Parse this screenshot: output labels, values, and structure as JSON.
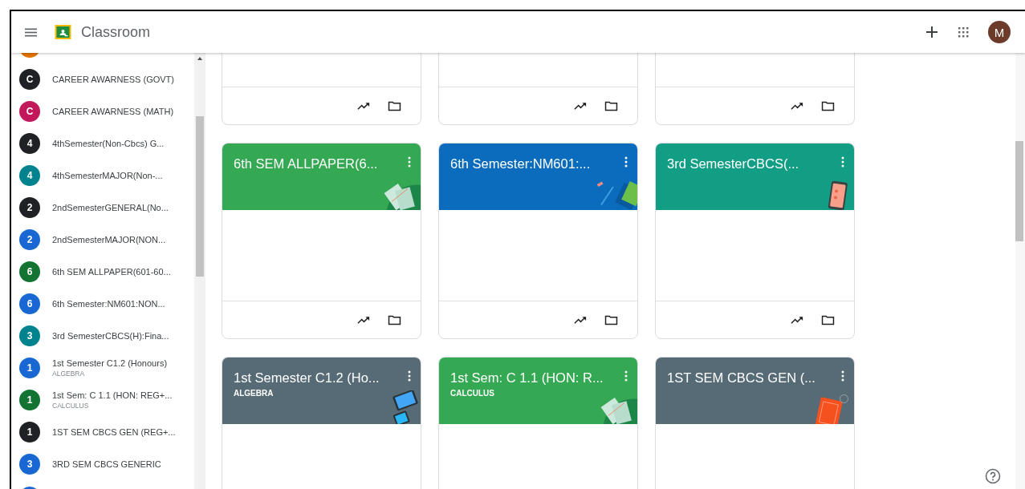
{
  "header": {
    "app_name": "Classroom",
    "avatar_letter": "M"
  },
  "sidebar": {
    "items": [
      {
        "kind": "partial",
        "color": "#e37400"
      },
      {
        "kind": "class",
        "letter": "C",
        "name": "CAREER AWARNESS (GOVT)",
        "color": "#202124"
      },
      {
        "kind": "class",
        "letter": "C",
        "name": "CAREER AWARNESS (MATH)",
        "color": "#c2185b"
      },
      {
        "kind": "class",
        "letter": "4",
        "name": "4thSemester(Non-Cbcs) G...",
        "color": "#202124"
      },
      {
        "kind": "class",
        "letter": "4",
        "name": "4thSemesterMAJOR(Non-...",
        "color": "#00838f"
      },
      {
        "kind": "class",
        "letter": "2",
        "name": "2ndSemesterGENERAL(No...",
        "color": "#202124"
      },
      {
        "kind": "class",
        "letter": "2",
        "name": "2ndSemesterMAJOR(NON...",
        "color": "#1967d2"
      },
      {
        "kind": "class",
        "letter": "6",
        "name": "6th SEM ALLPAPER(601-60...",
        "color": "#137333"
      },
      {
        "kind": "class",
        "letter": "6",
        "name": "6th Semester:NM601:NON...",
        "color": "#1967d2"
      },
      {
        "kind": "class",
        "letter": "3",
        "name": "3rd SemesterCBCS(H):Fina...",
        "color": "#00838f"
      },
      {
        "kind": "class",
        "letter": "1",
        "name": "1st Semester C1.2 (Honours)",
        "subtitle": "ALGEBRA",
        "color": "#1967d2"
      },
      {
        "kind": "class",
        "letter": "1",
        "name": "1st Sem: C 1.1 (HON: REG+...",
        "subtitle": "CALCULUS",
        "color": "#137333"
      },
      {
        "kind": "class",
        "letter": "1",
        "name": "1ST SEM CBCS GEN (REG+...",
        "color": "#202124"
      },
      {
        "kind": "class",
        "letter": "3",
        "name": "3RD SEM CBCS GENERIC",
        "color": "#1967d2"
      },
      {
        "kind": "partial-bottom",
        "color": "#1967d2"
      }
    ]
  },
  "cards": [
    {
      "kind": "bottom"
    },
    {
      "kind": "bottom"
    },
    {
      "kind": "bottom"
    },
    {
      "kind": "full",
      "title": "6th SEM ALLPAPER(6...",
      "color": "#34a853",
      "illustration": {
        "kind": "book"
      }
    },
    {
      "kind": "full",
      "title": "6th Semester:NM601:...",
      "color": "#0b6cbd",
      "illustration": {
        "kind": "pen"
      }
    },
    {
      "kind": "full",
      "title": "3rd SemesterCBCS(...",
      "color": "#129d85",
      "illustration": {
        "kind": "phone"
      }
    },
    {
      "kind": "top",
      "title": "1st Semester C1.2 (Ho...",
      "subtitle": "ALGEBRA",
      "color": "#566b76",
      "illustration": {
        "kind": "tablet"
      }
    },
    {
      "kind": "top",
      "title": "1st Sem: C 1.1 (HON: R...",
      "subtitle": "CALCULUS",
      "color": "#34a853",
      "illustration": {
        "kind": "book"
      }
    },
    {
      "kind": "top",
      "title": "1ST SEM CBCS GEN (...",
      "color": "#566b76",
      "illustration": {
        "kind": "notebook"
      }
    }
  ]
}
